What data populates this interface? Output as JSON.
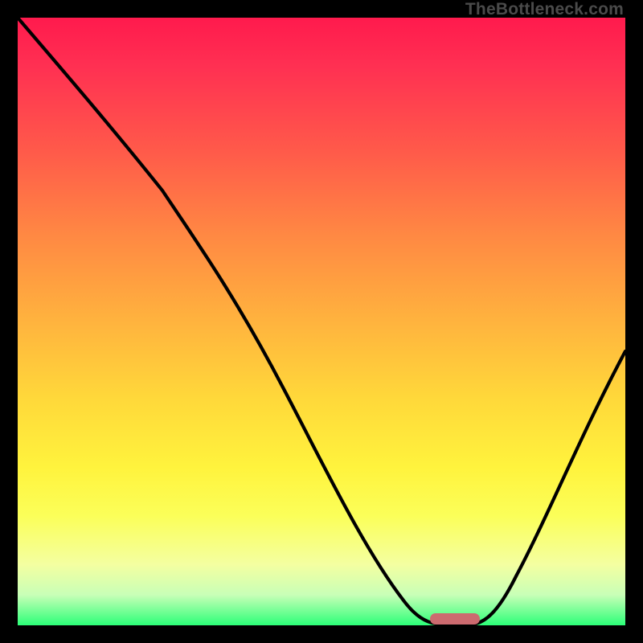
{
  "watermark": "TheBottleneck.com",
  "colors": {
    "frame": "#000000",
    "gradient_top": "#ff1a4d",
    "gradient_bottom": "#2cff78",
    "curve": "#000000",
    "marker": "#cc6a6f"
  },
  "chart_data": {
    "type": "line",
    "title": "",
    "xlabel": "",
    "ylabel": "",
    "xlim": [
      0,
      100
    ],
    "ylim": [
      0,
      100
    ],
    "x": [
      0,
      5,
      10,
      15,
      20,
      25,
      30,
      35,
      40,
      45,
      50,
      55,
      60,
      63,
      65,
      68,
      70,
      73,
      75,
      78,
      80,
      85,
      90,
      95,
      100
    ],
    "values": [
      100,
      95,
      89,
      83,
      77,
      71,
      63,
      55,
      47,
      39,
      31,
      23,
      15,
      9,
      5,
      1,
      0,
      0,
      0,
      1,
      4,
      12,
      22,
      33,
      45
    ],
    "marker": {
      "x_start": 68,
      "x_end": 76,
      "y": 0
    }
  }
}
